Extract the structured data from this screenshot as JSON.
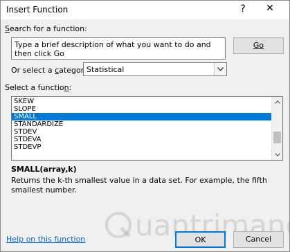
{
  "window": {
    "title": "Insert Function",
    "help_glyph": "?",
    "close_glyph": "✕"
  },
  "search": {
    "label_pre": "",
    "label_key": "S",
    "label_post": "earch for a function:",
    "value": "Type a brief description of what you want to do and then click Go",
    "go_label": "Go"
  },
  "category": {
    "label_pre": "Or select a ",
    "label_key": "c",
    "label_post": "ategory:",
    "selected": "Statistical"
  },
  "functions": {
    "label_pre": "Select a functio",
    "label_key": "n",
    "label_post": ":",
    "items": [
      "SKEW",
      "SLOPE",
      "SMALL",
      "STANDARDIZE",
      "STDEV",
      "STDEVA",
      "STDEVP"
    ],
    "selected_index": 2
  },
  "details": {
    "signature": "SMALL(array,k)",
    "description": "Returns the k-th smallest value in a data set. For example, the fifth smallest number."
  },
  "footer": {
    "help_link": "Help on this function",
    "ok_label": "OK",
    "cancel_label": "Cancel"
  },
  "watermark": {
    "text": "uantrimang"
  }
}
